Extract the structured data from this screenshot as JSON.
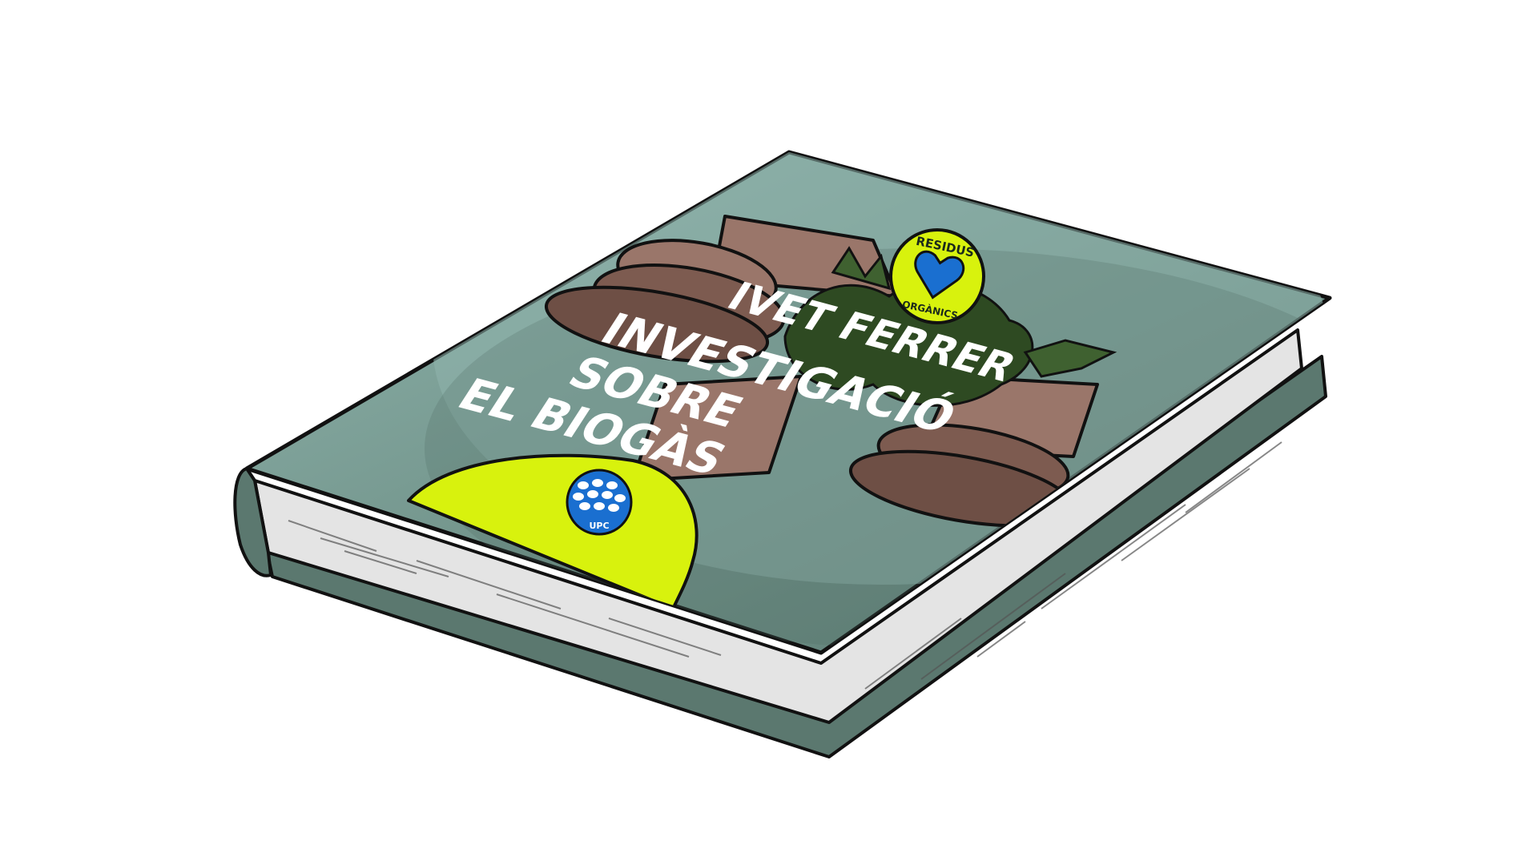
{
  "book": {
    "author": "IVET FERRER",
    "title_lines": [
      "INVESTIGACIÓ",
      "SOBRE",
      "EL BIOGÀS"
    ],
    "badge_top": "RESIDUS",
    "badge_bottom": "ORGÀNICS",
    "logo_text": "UPC"
  },
  "colors": {
    "background": "#ffffff",
    "cover_light": "#8fb5ad",
    "cover_mid": "#6e8f86",
    "cover_dark": "#4e6b63",
    "spine": "#5b786f",
    "pages": "#e4e4e4",
    "accent_yellow": "#d8f20d",
    "upc_blue": "#1a6fd0",
    "pot": "#9a766a",
    "pot_dark": "#6e4f45",
    "leaves": "#2e4a22"
  },
  "icons": {
    "badge": "heart-icon",
    "logo": "upc-logo"
  }
}
